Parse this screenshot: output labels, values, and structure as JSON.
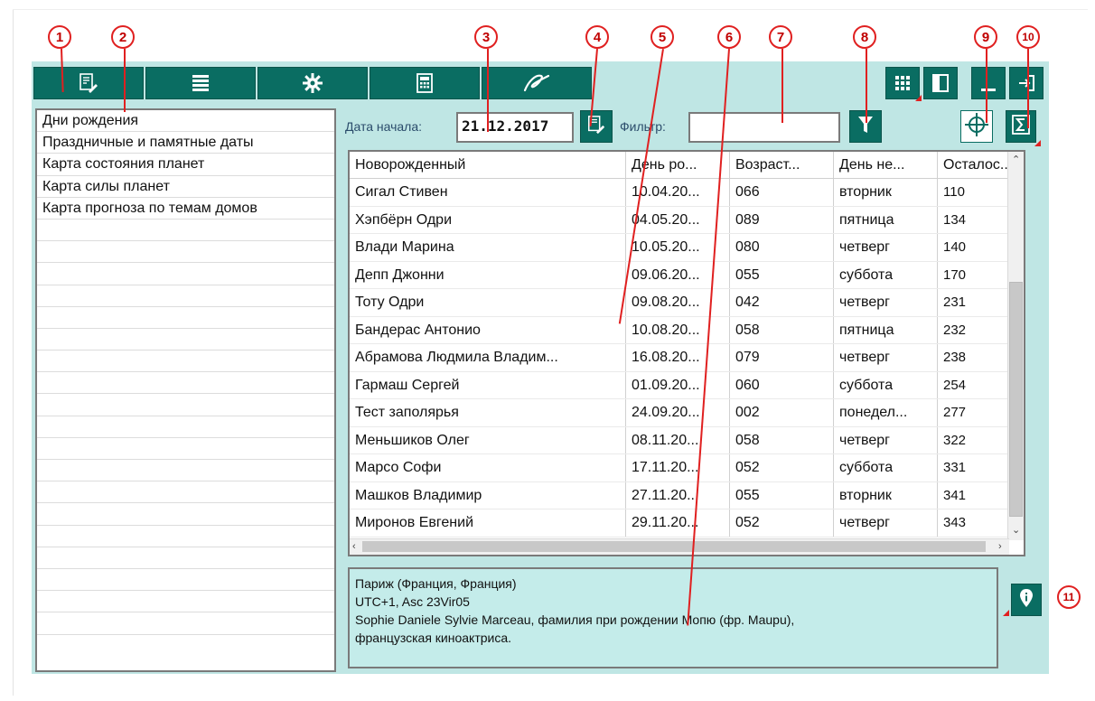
{
  "callouts": [
    "1",
    "2",
    "3",
    "4",
    "5",
    "6",
    "7",
    "8",
    "9",
    "10",
    "11"
  ],
  "toolbar": {
    "left_icons": [
      "chart-document-icon",
      "list-icon",
      "gear-icon",
      "calculator-icon",
      "signature-icon"
    ],
    "right_icons": [
      "grid-view-icon",
      "panel-icon",
      "minimize-icon",
      "exit-icon"
    ]
  },
  "left_list": {
    "items": [
      "Дни рождения",
      "Праздничные и памятные даты",
      "Карта состояния планет",
      "Карта силы планет",
      "Карта прогноза по темам домов"
    ]
  },
  "params": {
    "start_date_label": "Дата начала:",
    "start_date_value": "21.12.2017",
    "filter_label": "Фильтр:",
    "filter_value": ""
  },
  "table": {
    "columns": [
      "Новорожденный",
      "День ро...",
      "Возраст...",
      "День не...",
      "Осталос..."
    ],
    "rows": [
      [
        "Сигал Стивен",
        "10.04.20...",
        "066",
        "вторник",
        "110"
      ],
      [
        "Хэпбёрн Одри",
        "04.05.20...",
        "089",
        "пятница",
        "134"
      ],
      [
        "Влади Марина",
        "10.05.20...",
        "080",
        "четверг",
        "140"
      ],
      [
        "Депп Джонни",
        "09.06.20...",
        "055",
        "суббота",
        "170"
      ],
      [
        "Тоту Одри",
        "09.08.20...",
        "042",
        "четверг",
        "231"
      ],
      [
        "Бандерас Антонио",
        "10.08.20...",
        "058",
        "пятница",
        "232"
      ],
      [
        "Абрамова Людмила Владим...",
        "16.08.20...",
        "079",
        "четверг",
        "238"
      ],
      [
        "Гармаш Сергей",
        "01.09.20...",
        "060",
        "суббота",
        "254"
      ],
      [
        "Тест заполярья",
        "24.09.20...",
        "002",
        "понедел...",
        "277"
      ],
      [
        "Меньшиков Олег",
        "08.11.20...",
        "058",
        "четверг",
        "322"
      ],
      [
        "Марсо Софи",
        "17.11.20...",
        "052",
        "суббота",
        "331"
      ],
      [
        "Машков Владимир",
        "27.11.20...",
        "055",
        "вторник",
        "341"
      ],
      [
        "Миронов Евгений",
        "29.11.20...",
        "052",
        "четверг",
        "343"
      ]
    ]
  },
  "info": {
    "lines": [
      "Париж (Франция, Франция)",
      "UTC+1, Asc 23Vir05",
      "Sophie Daniele Sylvie Marceau, фамилия при рождении Мопю (фр. Maupu),",
      "французская киноактриса."
    ]
  },
  "colors": {
    "toolbar_button": "#0a6d62",
    "panel_background": "#bfe6e4",
    "callout_red": "#e02020"
  }
}
